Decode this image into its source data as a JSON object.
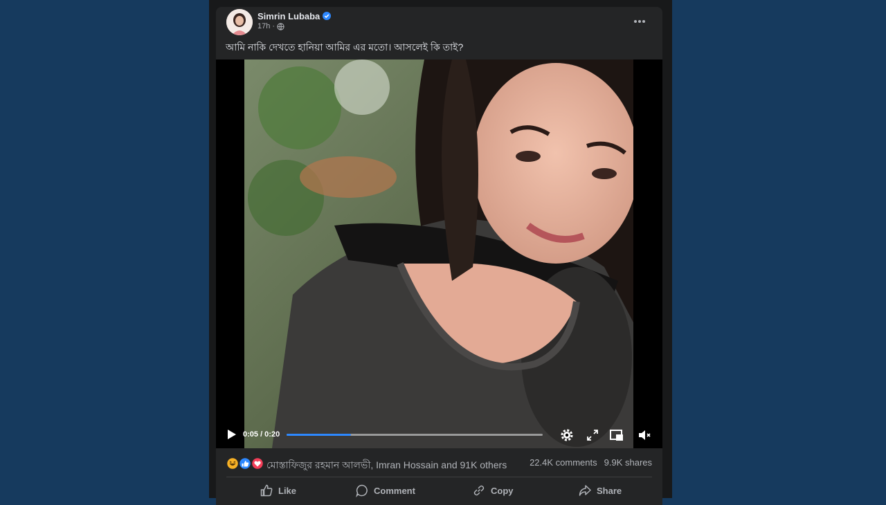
{
  "post": {
    "author": "Simrin Lubaba",
    "time": "17h",
    "separator": "·",
    "caption": "আমি নাকি দেখতে হানিয়া আমির এর মতো।  আসলেই কি তাই?"
  },
  "video": {
    "time_label": "0:05 / 0:20",
    "progress": 0.25
  },
  "reactions": {
    "icons": [
      "haha-icon",
      "like-icon",
      "love-icon"
    ],
    "names": "মোস্তাফিজুর রহমান আলভী, Imran Hossain and 91K others",
    "comments": "22.4K comments",
    "shares": "9.9K shares"
  },
  "actions": {
    "like": "Like",
    "comment": "Comment",
    "copy": "Copy",
    "share": "Share"
  },
  "colors": {
    "background": "#163a5e",
    "card": "#242526",
    "accent": "#2d88ff",
    "love": "#f33e58",
    "haha": "#f7b125"
  }
}
